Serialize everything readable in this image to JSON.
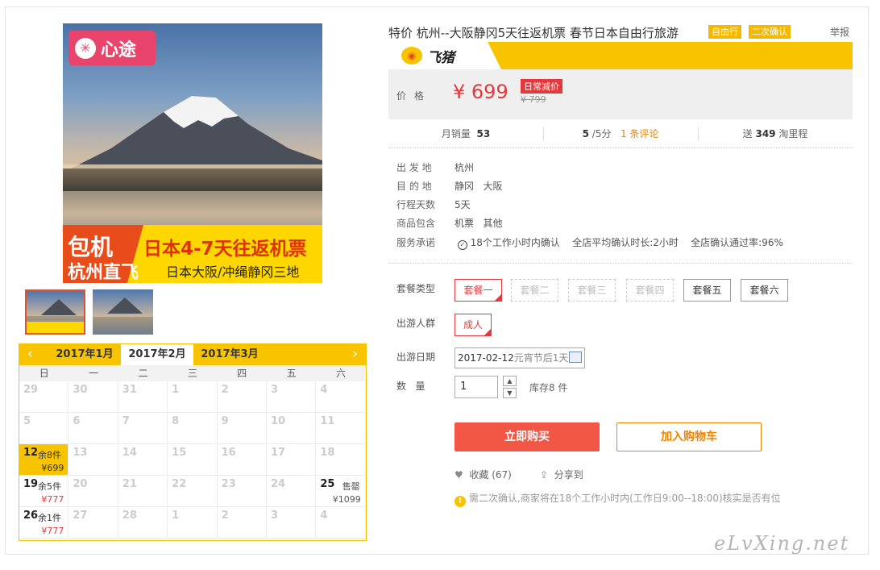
{
  "hero": {
    "brand": "心途",
    "banner_left_1": "包机",
    "banner_left_2": "杭州直飞",
    "banner_right_1": "日本4-7天往返机票",
    "banner_right_2": "日本大阪/冲绳静冈三地"
  },
  "calendar": {
    "prev": "‹",
    "next": "›",
    "months": [
      "2017年1月",
      "2017年2月",
      "2017年3月"
    ],
    "active_month": "2017年2月",
    "weekdays": [
      "日",
      "一",
      "二",
      "三",
      "四",
      "五",
      "六"
    ],
    "rows": [
      [
        {
          "d": "29"
        },
        {
          "d": "30"
        },
        {
          "d": "31"
        },
        {
          "d": "1"
        },
        {
          "d": "2"
        },
        {
          "d": "3"
        },
        {
          "d": "4"
        }
      ],
      [
        {
          "d": "5"
        },
        {
          "d": "6"
        },
        {
          "d": "7"
        },
        {
          "d": "8"
        },
        {
          "d": "9"
        },
        {
          "d": "10"
        },
        {
          "d": "11"
        }
      ],
      [
        {
          "d": "12",
          "stock": "余8件",
          "price": "¥699",
          "hl": true
        },
        {
          "d": "13"
        },
        {
          "d": "14"
        },
        {
          "d": "15"
        },
        {
          "d": "16"
        },
        {
          "d": "17"
        },
        {
          "d": "18"
        }
      ],
      [
        {
          "d": "19",
          "stock": "余5件",
          "price": "¥777"
        },
        {
          "d": "20"
        },
        {
          "d": "21"
        },
        {
          "d": "22"
        },
        {
          "d": "23"
        },
        {
          "d": "24"
        },
        {
          "d": "25",
          "sold": "售罄",
          "price": "¥1099"
        }
      ],
      [
        {
          "d": "26",
          "stock": "余1件",
          "price": "¥777"
        },
        {
          "d": "27"
        },
        {
          "d": "28"
        },
        {
          "d": "1"
        },
        {
          "d": "2"
        },
        {
          "d": "3"
        },
        {
          "d": "4"
        }
      ]
    ]
  },
  "product": {
    "title": "特价 杭州--大阪静冈5天往返机票 春节日本自由行旅游",
    "tag1": "自由行",
    "tag2": "二次确认",
    "report": "举报",
    "platform": "飞猪",
    "platform_icon": "pig-icon"
  },
  "price": {
    "label": "价格",
    "current": "¥ 699",
    "promo": "日常减价",
    "original": "¥ 799"
  },
  "stats": {
    "monthly_label": "月销量",
    "monthly_value": "53",
    "rating_value": "5",
    "rating_suffix": "/5分",
    "reviews": "1 条评论",
    "miles_prefix": "送",
    "miles_value": "349",
    "miles_suffix": "淘里程"
  },
  "info": {
    "depart_label": "出 发 地",
    "depart": "杭州",
    "dest_label": "目 的 地",
    "dest": "静冈   大阪",
    "days_label": "行程天数",
    "days": "5天",
    "includes_label": "商品包含",
    "includes": "机票   其他",
    "service_label": "服务承诺",
    "service_1": "18个工作小时内确认",
    "service_2": "全店平均确认时长:2小时",
    "service_3": "全店确认通过率:96%"
  },
  "options": {
    "package_label": "套餐类型",
    "packages": [
      "套餐一",
      "套餐二",
      "套餐三",
      "套餐四",
      "套餐五",
      "套餐六"
    ],
    "traveler_label": "出游人群",
    "traveler": "成人",
    "date_label": "出游日期",
    "date_value": "2017-02-12",
    "date_sub": "元宵节后1天",
    "qty_label": "数   量",
    "qty_value": "1",
    "stock": "库存8 件"
  },
  "actions": {
    "buy": "立即购买",
    "cart": "加入购物车",
    "favorite": "收藏 (67)",
    "share": "分享到",
    "notice": "需二次确认,商家将在18个工作小时内(工作日9:00--18:00)核实是否有位"
  },
  "watermark": "eLvXing.net",
  "colors": {
    "accent": "#f8c400",
    "price_red": "#e4393c",
    "buy_button": "#f15744",
    "cart_orange": "#f08300"
  }
}
